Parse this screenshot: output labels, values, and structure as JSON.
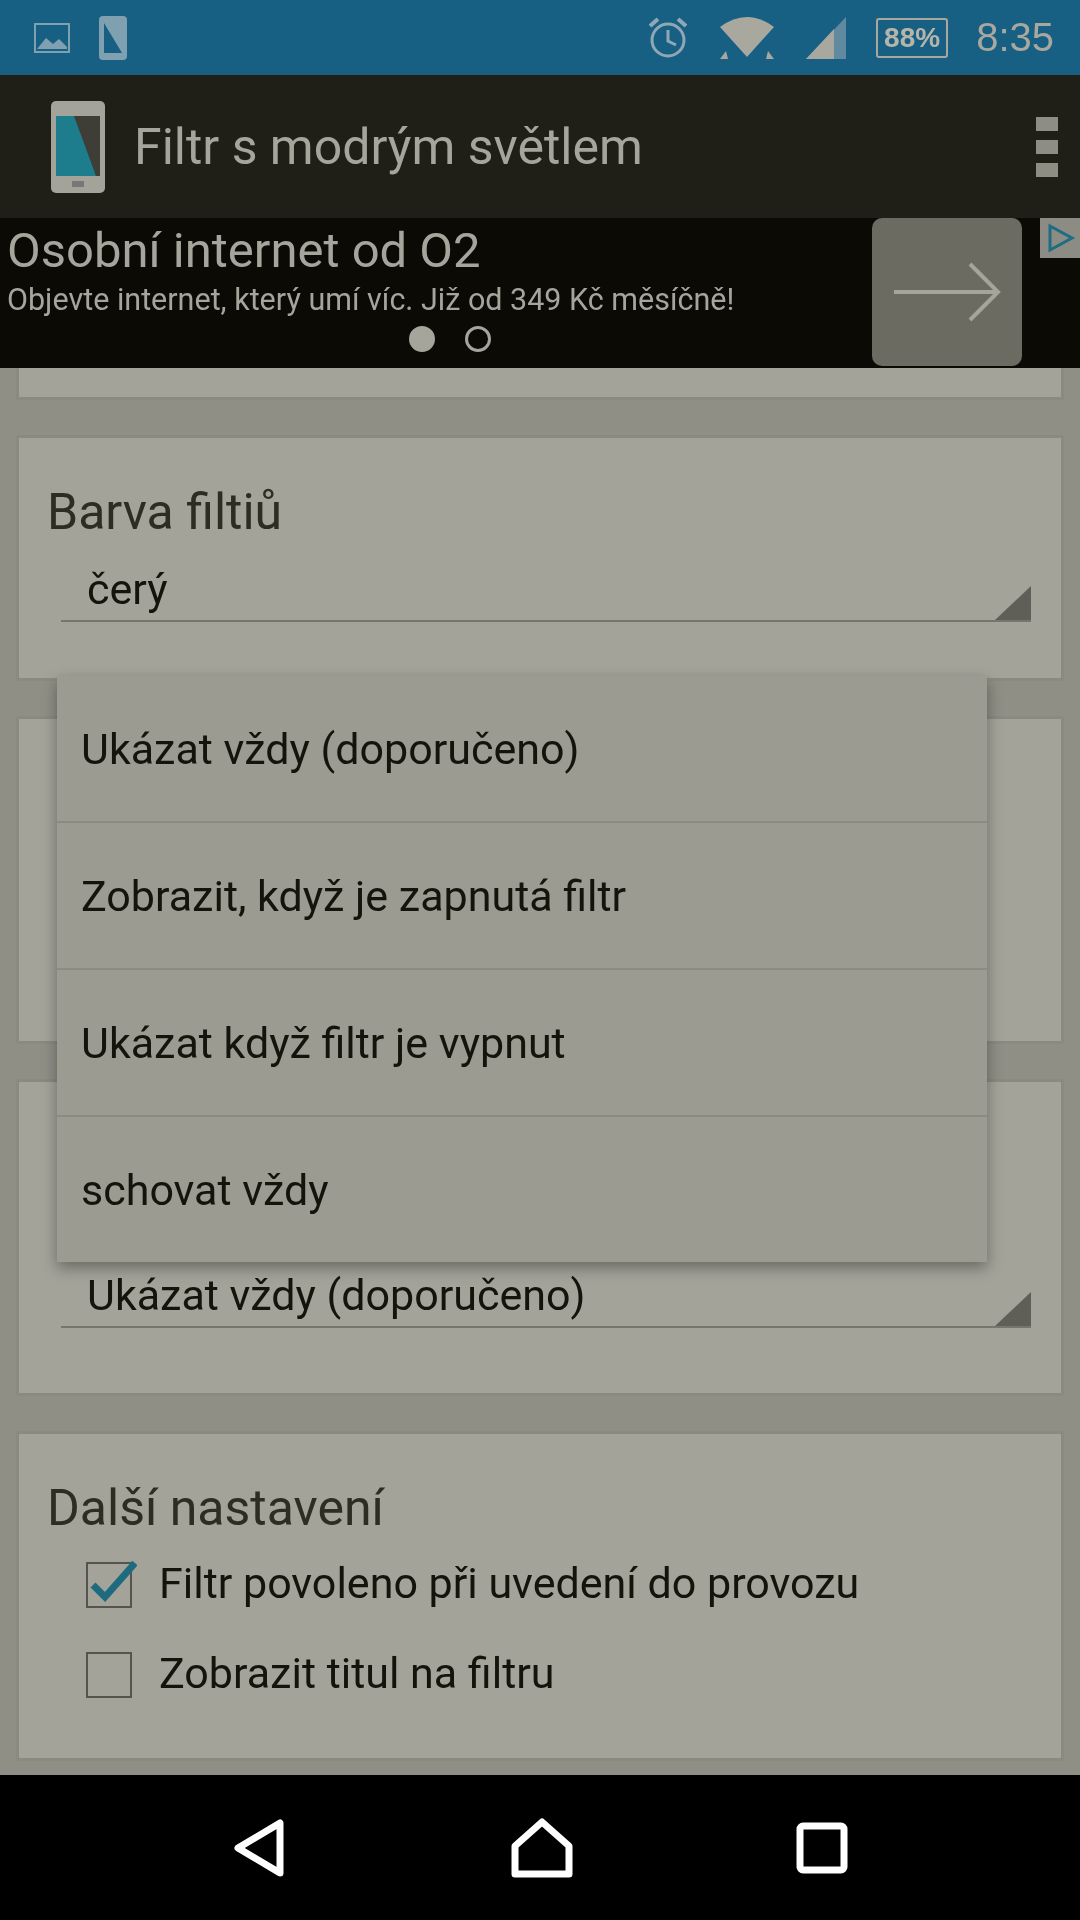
{
  "status_bar": {
    "battery": "88%",
    "time": "8:35"
  },
  "app_bar": {
    "title": "Filtr s modrým světlem"
  },
  "ad": {
    "title": "Osobní internet od O2",
    "text": "Objevte internet, který umí víc. Již od 349 Kč měsíčně!",
    "pages": [
      {
        "selected": true
      },
      {
        "selected": false
      }
    ]
  },
  "cards": [
    {
      "kind": "cut"
    },
    {
      "kind": "select",
      "title": "Barva filtiů",
      "value": "čerý"
    },
    {
      "kind": "blank"
    },
    {
      "kind": "select",
      "value": "Ukázat vždy (doporučeno)"
    },
    {
      "kind": "checks",
      "title": "Další nastavení",
      "options": [
        {
          "label": "Filtr povoleno při uvedení do provozu",
          "checked": true
        },
        {
          "label": "Zobrazit titul na filtru",
          "checked": false
        }
      ]
    }
  ],
  "dropdown_menu": {
    "items": [
      "Ukázat vždy (doporučeno)",
      "Zobrazit, když je zapnutá filtr",
      "Ukázat když filtr je vypnut",
      "schovat vždy"
    ]
  }
}
